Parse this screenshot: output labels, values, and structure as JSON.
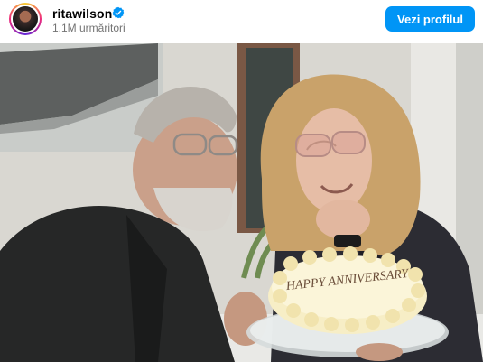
{
  "profile": {
    "username": "ritawilson",
    "followers": "1.1M urmăritori",
    "verified": true,
    "follow_button": "Vezi profilul"
  },
  "post": {
    "cake_text": "HAPPY ANNIVERSARY"
  },
  "colors": {
    "accent": "#0095f6",
    "verified": "#0095f6"
  },
  "icons": {
    "verified": "verified-badge-icon",
    "avatar": "profile-avatar"
  }
}
